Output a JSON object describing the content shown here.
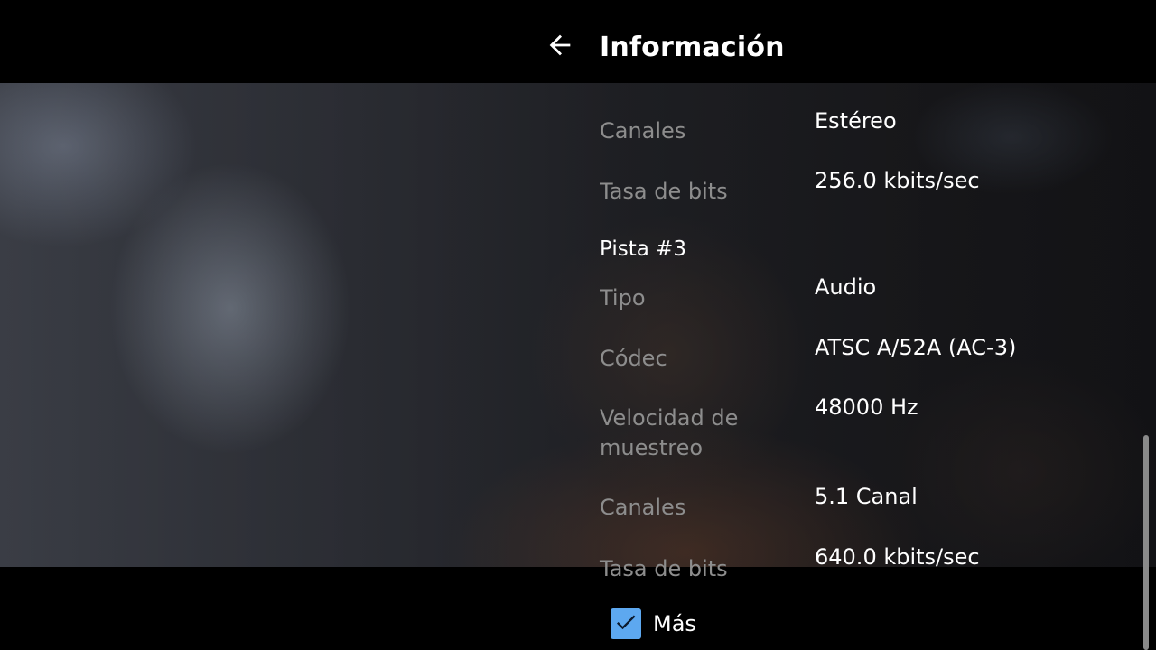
{
  "header": {
    "title": "Información",
    "back_icon": "arrow-left-icon"
  },
  "info": {
    "prev_track": {
      "rows": [
        {
          "label": "Canales",
          "value": "Estéreo"
        },
        {
          "label": "Tasa de bits",
          "value": "256.0 kbits/sec"
        }
      ]
    },
    "track3": {
      "title": "Pista #3",
      "rows": [
        {
          "label": "Tipo",
          "value": "Audio"
        },
        {
          "label": "Códec",
          "value": "ATSC A/52A (AC-3)"
        },
        {
          "label": "Velocidad de muestreo",
          "value": "48000 Hz"
        },
        {
          "label": "Canales",
          "value": "5.1 Canal"
        },
        {
          "label": "Tasa de bits",
          "value": "640.0 kbits/sec"
        }
      ]
    }
  },
  "footer": {
    "more_label": "Más",
    "more_checked": true,
    "checkbox_color": "#5da8f0"
  },
  "colors": {
    "label": "#8d8d8d",
    "value": "#ffffff",
    "bar_background": "#000000"
  }
}
